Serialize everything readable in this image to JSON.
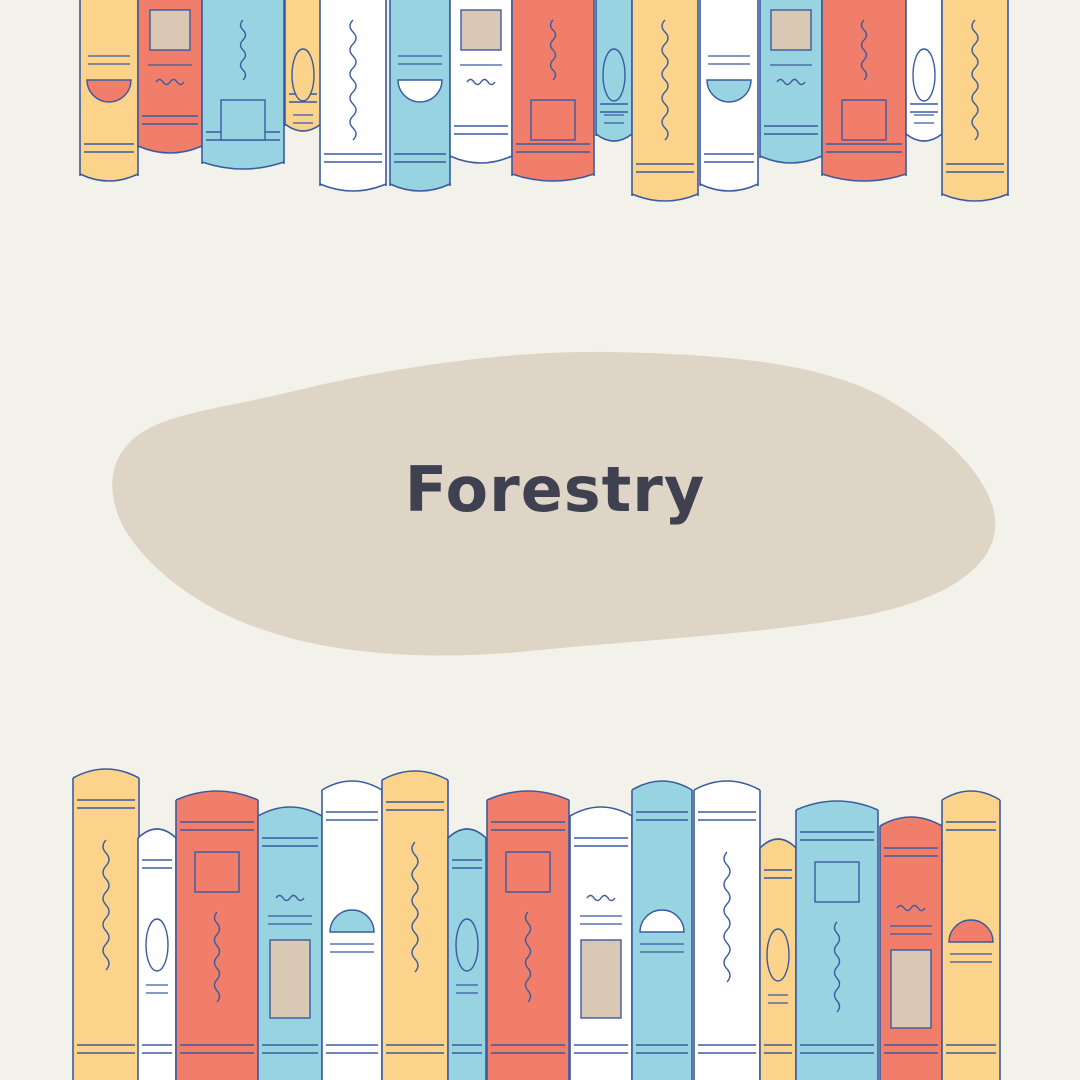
{
  "title": "Forestry",
  "colors": {
    "background": "#F3F2EA",
    "blob": "#DFD5C6",
    "title": "#3F4150",
    "outline": "#3B5BA0",
    "yellow": "#FCD38A",
    "red": "#F07E6A",
    "blue": "#98D3E2",
    "white": "#FFFFFF",
    "tan": "#D8C8B4"
  },
  "shelves": {
    "top": [
      {
        "color": "yellow",
        "motif": "half-circle",
        "accent": "red"
      },
      {
        "color": "red",
        "motif": "scribble-label",
        "accent": "tan"
      },
      {
        "color": "blue",
        "motif": "squiggle-box",
        "accent": "blue"
      },
      {
        "color": "yellow",
        "motif": "oval",
        "accent": "yellow"
      },
      {
        "color": "white",
        "motif": "squiggles",
        "accent": "white"
      },
      {
        "color": "blue",
        "motif": "half-circle",
        "accent": "white"
      },
      {
        "color": "white",
        "motif": "scribble-label",
        "accent": "tan"
      },
      {
        "color": "red",
        "motif": "squiggle-box",
        "accent": "red"
      },
      {
        "color": "blue",
        "motif": "oval",
        "accent": "blue"
      },
      {
        "color": "yellow",
        "motif": "squiggles",
        "accent": "yellow"
      },
      {
        "color": "white",
        "motif": "half-circle",
        "accent": "blue"
      },
      {
        "color": "blue",
        "motif": "scribble-label",
        "accent": "tan"
      },
      {
        "color": "red",
        "motif": "squiggle-box",
        "accent": "red"
      },
      {
        "color": "white",
        "motif": "oval",
        "accent": "white"
      },
      {
        "color": "yellow",
        "motif": "squiggles",
        "accent": "yellow"
      }
    ],
    "bottom": [
      {
        "color": "yellow",
        "motif": "squiggles",
        "accent": "yellow"
      },
      {
        "color": "white",
        "motif": "oval",
        "accent": "white"
      },
      {
        "color": "red",
        "motif": "box-squiggle",
        "accent": "red"
      },
      {
        "color": "blue",
        "motif": "scribble-label",
        "accent": "tan"
      },
      {
        "color": "white",
        "motif": "half-circle",
        "accent": "blue"
      },
      {
        "color": "yellow",
        "motif": "squiggles",
        "accent": "yellow"
      },
      {
        "color": "blue",
        "motif": "oval",
        "accent": "blue"
      },
      {
        "color": "red",
        "motif": "box-squiggle",
        "accent": "red"
      },
      {
        "color": "white",
        "motif": "scribble-label",
        "accent": "tan"
      },
      {
        "color": "blue",
        "motif": "half-circle",
        "accent": "white"
      },
      {
        "color": "white",
        "motif": "squiggles",
        "accent": "white"
      },
      {
        "color": "yellow",
        "motif": "oval",
        "accent": "yellow"
      },
      {
        "color": "blue",
        "motif": "box-squiggle",
        "accent": "blue"
      },
      {
        "color": "red",
        "motif": "scribble-label",
        "accent": "tan"
      },
      {
        "color": "yellow",
        "motif": "half-circle",
        "accent": "red"
      }
    ]
  }
}
